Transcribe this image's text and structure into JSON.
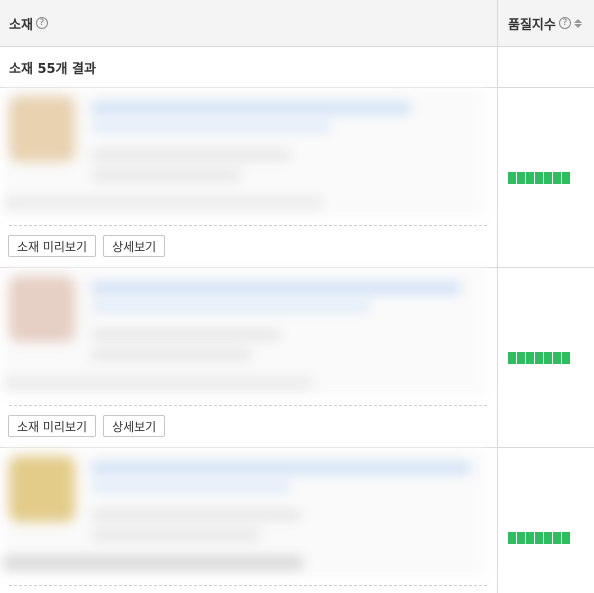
{
  "header": {
    "creative_label": "소재",
    "quality_label": "품질지수",
    "help_glyph": "?"
  },
  "results": {
    "summary": "소재 55개 결과"
  },
  "buttons": {
    "preview_label": "소재 미리보기",
    "detail_label": "상세보기"
  },
  "quality_color": "#2dbe60",
  "ads": [
    {
      "quality_level": 7,
      "quality_max": 7,
      "thumb_color": "#e8d2b0"
    },
    {
      "quality_level": 7,
      "quality_max": 7,
      "thumb_color": "#e6cfc4"
    },
    {
      "quality_level": 7,
      "quality_max": 7,
      "thumb_color": "#e3cc8a"
    }
  ]
}
